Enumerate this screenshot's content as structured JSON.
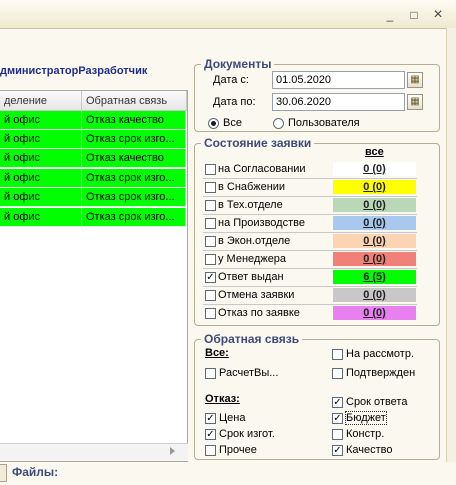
{
  "window": {
    "minimize_icon": "_",
    "maximize_icon": "□",
    "close_icon": "×"
  },
  "left": {
    "user": "дминистраторРазработчик",
    "columns": [
      "деление",
      "Обратная связь"
    ],
    "rows": [
      {
        "c1": "й офис",
        "c2": "Отказ качество"
      },
      {
        "c1": "й офис",
        "c2": "Отказ срок изго..."
      },
      {
        "c1": "й офис",
        "c2": "Отказ качество"
      },
      {
        "c1": "й офис",
        "c2": "Отказ срок изго..."
      },
      {
        "c1": "й офис",
        "c2": "Отказ срок изго..."
      },
      {
        "c1": "й офис",
        "c2": "Отказ срок изго..."
      }
    ],
    "row_color": "#00ff00"
  },
  "files_label": "Файлы:",
  "documents": {
    "title": "Документы",
    "date_from_label": "Дата с:",
    "date_from": "01.05.2020",
    "date_to_label": "Дата по:",
    "date_to": "30.06.2020",
    "radio_all": "Все",
    "radio_user": "Пользователя"
  },
  "status": {
    "title": "Состояние заявки",
    "all_header": "все",
    "items": [
      {
        "label": "на Согласовании",
        "count": "0 (0)",
        "checked": false,
        "color": "#ffffff"
      },
      {
        "label": "в Снабжении",
        "count": "0 (0)",
        "checked": false,
        "color": "#ffff00"
      },
      {
        "label": "в Тех.отделе",
        "count": "0 (0)",
        "checked": false,
        "color": "#b8d8b8"
      },
      {
        "label": "на Производстве",
        "count": "0 (0)",
        "checked": false,
        "color": "#a8c8f0"
      },
      {
        "label": "в Экон.отделе",
        "count": "0 (0)",
        "checked": false,
        "color": "#fcd4b4"
      },
      {
        "label": "у Менеджера",
        "count": "0 (0)",
        "checked": false,
        "color": "#f08078"
      },
      {
        "label": "Ответ выдан",
        "count": "6 (5)",
        "checked": true,
        "color": "#00ff00"
      },
      {
        "label": "Отмена заявки",
        "count": "0 (0)",
        "checked": false,
        "color": "#c8c8c8"
      },
      {
        "label": "Отказ по заявке",
        "count": "0 (0)",
        "checked": false,
        "color": "#e880f0"
      }
    ]
  },
  "feedback": {
    "title": "Обратная связь",
    "all_label": "Все:",
    "refusal_label": "Отказ:",
    "left_items": [
      {
        "label": "РасчетВы...",
        "checked": false
      },
      {
        "label": "Цена",
        "checked": true
      },
      {
        "label": "Срок изгот.",
        "checked": true
      },
      {
        "label": "Прочее",
        "checked": false
      }
    ],
    "right_items": [
      {
        "label": "На рассмотр.",
        "checked": false
      },
      {
        "label": "Подтвержден",
        "checked": false
      },
      {
        "label": "Срок ответа",
        "checked": true
      },
      {
        "label": "Бюджет",
        "checked": true
      },
      {
        "label": "Констр.",
        "checked": false
      },
      {
        "label": "Качество",
        "checked": true
      }
    ]
  }
}
